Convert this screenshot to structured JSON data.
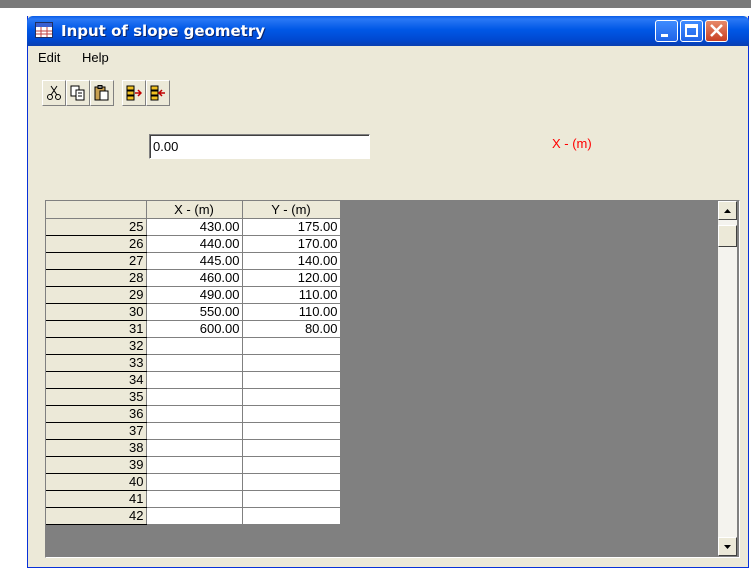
{
  "window": {
    "title": "Input of slope geometry"
  },
  "menu": [
    "Edit",
    "Help"
  ],
  "toolbar": {
    "buttons": [
      "cut-icon",
      "copy-icon",
      "paste-icon",
      "insert-row-icon",
      "delete-row-icon"
    ]
  },
  "input": {
    "value": "0.00"
  },
  "column_label": "X - (m)",
  "grid": {
    "headers": [
      "X - (m)",
      "Y - (m)"
    ],
    "rows": [
      {
        "n": "25",
        "x": "430.00",
        "y": "175.00"
      },
      {
        "n": "26",
        "x": "440.00",
        "y": "170.00"
      },
      {
        "n": "27",
        "x": "445.00",
        "y": "140.00"
      },
      {
        "n": "28",
        "x": "460.00",
        "y": "120.00"
      },
      {
        "n": "29",
        "x": "490.00",
        "y": "110.00"
      },
      {
        "n": "30",
        "x": "550.00",
        "y": "110.00"
      },
      {
        "n": "31",
        "x": "600.00",
        "y": "80.00"
      },
      {
        "n": "32",
        "x": "",
        "y": ""
      },
      {
        "n": "33",
        "x": "",
        "y": ""
      },
      {
        "n": "34",
        "x": "",
        "y": ""
      },
      {
        "n": "35",
        "x": "",
        "y": ""
      },
      {
        "n": "36",
        "x": "",
        "y": ""
      },
      {
        "n": "37",
        "x": "",
        "y": ""
      },
      {
        "n": "38",
        "x": "",
        "y": ""
      },
      {
        "n": "39",
        "x": "",
        "y": ""
      },
      {
        "n": "40",
        "x": "",
        "y": ""
      },
      {
        "n": "41",
        "x": "",
        "y": ""
      },
      {
        "n": "42",
        "x": "",
        "y": ""
      }
    ]
  },
  "colors": {
    "title_bar": "#0058e6",
    "label_red": "#ff0000",
    "face": "#ece9d8"
  }
}
